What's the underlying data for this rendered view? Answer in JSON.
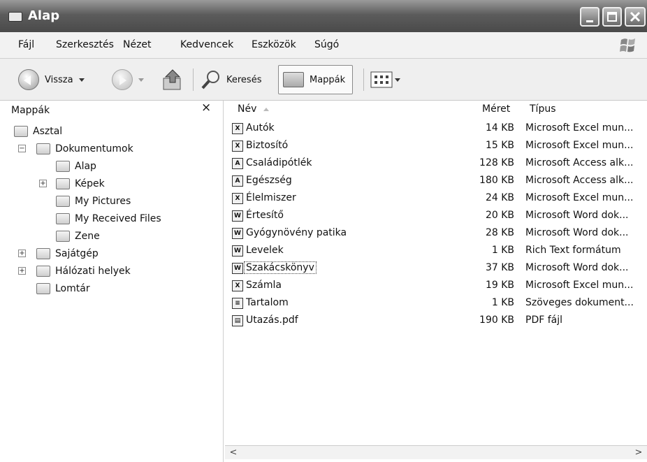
{
  "window": {
    "title": "Alap"
  },
  "menu": [
    "Fájl",
    "Szerkesztés",
    "Nézet",
    "Kedvencek",
    "Eszközök",
    "Súgó"
  ],
  "toolbar": {
    "back": "Vissza",
    "search": "Keresés",
    "folders": "Mappák"
  },
  "folders_pane": {
    "header": "Mappák",
    "close": "×",
    "items": [
      {
        "label": "Asztal",
        "icon": "desktop-icon"
      },
      {
        "label": "Dokumentumok",
        "icon": "documents-folder-icon",
        "expander": "−"
      },
      {
        "label": "Alap",
        "icon": "folder-open-icon"
      },
      {
        "label": "Képek",
        "icon": "pictures-folder-icon",
        "expander": "+"
      },
      {
        "label": "My Pictures",
        "icon": "folder-icon"
      },
      {
        "label": "My Received Files",
        "icon": "folder-icon"
      },
      {
        "label": "Zene",
        "icon": "music-folder-icon"
      },
      {
        "label": "Sajátgép",
        "icon": "computer-icon",
        "expander": "+"
      },
      {
        "label": "Hálózati helyek",
        "icon": "network-icon",
        "expander": "+"
      },
      {
        "label": "Lomtár",
        "icon": "recycle-bin-icon"
      }
    ]
  },
  "file_list": {
    "columns": {
      "name": "Név",
      "size": "Méret",
      "type": "Típus"
    },
    "rows": [
      {
        "name": "Autók",
        "size": "14 KB",
        "type": "Microsoft Excel mun...",
        "icon": "excel-file-icon",
        "glyph": "X"
      },
      {
        "name": "Biztosító",
        "size": "15 KB",
        "type": "Microsoft Excel mun...",
        "icon": "excel-file-icon",
        "glyph": "X"
      },
      {
        "name": "Családipótlék",
        "size": "128 KB",
        "type": "Microsoft Access alk...",
        "icon": "access-file-icon",
        "glyph": "A"
      },
      {
        "name": "Egészség",
        "size": "180 KB",
        "type": "Microsoft Access alk...",
        "icon": "access-file-icon",
        "glyph": "A"
      },
      {
        "name": "Élelmiszer",
        "size": "24 KB",
        "type": "Microsoft Excel mun...",
        "icon": "excel-file-icon",
        "glyph": "X"
      },
      {
        "name": "Értesítő",
        "size": "20 KB",
        "type": "Microsoft Word dok...",
        "icon": "word-file-icon",
        "glyph": "W"
      },
      {
        "name": "Gyógynövény patika",
        "size": "28 KB",
        "type": "Microsoft Word dok...",
        "icon": "word-file-icon",
        "glyph": "W"
      },
      {
        "name": "Levelek",
        "size": "1 KB",
        "type": "Rich Text formátum",
        "icon": "rtf-file-icon",
        "glyph": "W"
      },
      {
        "name": "Szakácskönyv",
        "size": "37 KB",
        "type": "Microsoft Word dok...",
        "icon": "word-file-icon",
        "glyph": "W"
      },
      {
        "name": "Számla",
        "size": "19 KB",
        "type": "Microsoft Excel mun...",
        "icon": "excel-file-icon",
        "glyph": "X"
      },
      {
        "name": "Tartalom",
        "size": "1 KB",
        "type": "Szöveges dokument...",
        "icon": "text-file-icon",
        "glyph": "≡"
      },
      {
        "name": "Utazás.pdf",
        "size": "190 KB",
        "type": "PDF fájl",
        "icon": "pdf-file-icon",
        "glyph": "▤"
      }
    ]
  },
  "scrollbar": {
    "left": "<",
    "right": ">"
  }
}
